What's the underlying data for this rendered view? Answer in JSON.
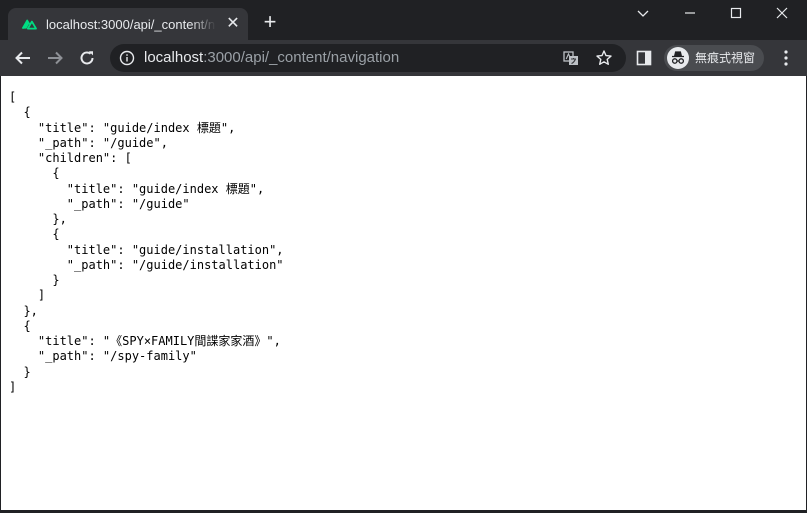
{
  "tab": {
    "title": "localhost:3000/api/_content/navigation",
    "favicon": "nuxt-logo-icon",
    "close_icon": "✕",
    "new_tab_icon": "+"
  },
  "window_controls": [
    "minimize-icon",
    "maximize-icon",
    "close-icon"
  ],
  "toolbar": {
    "url_host": "localhost",
    "url_rest": ":3000/api/_content/navigation",
    "profile_label": "無痕式視窗"
  },
  "colors": {
    "frame": "#202124",
    "toolbar": "#35363a",
    "tab_active": "#35363a",
    "nuxt_green": "#00dc82",
    "url_dim": "#9aa0a6",
    "text_light": "#e8eaed",
    "page_bg": "#ffffff"
  },
  "page": {
    "json_text": "[\n  {\n    \"title\": \"guide/index 標題\",\n    \"_path\": \"/guide\",\n    \"children\": [\n      {\n        \"title\": \"guide/index 標題\",\n        \"_path\": \"/guide\"\n      },\n      {\n        \"title\": \"guide/installation\",\n        \"_path\": \"/guide/installation\"\n      }\n    ]\n  },\n  {\n    \"title\": \"《SPY×FAMILY間諜家家酒》\",\n    \"_path\": \"/spy-family\"\n  }\n]"
  }
}
